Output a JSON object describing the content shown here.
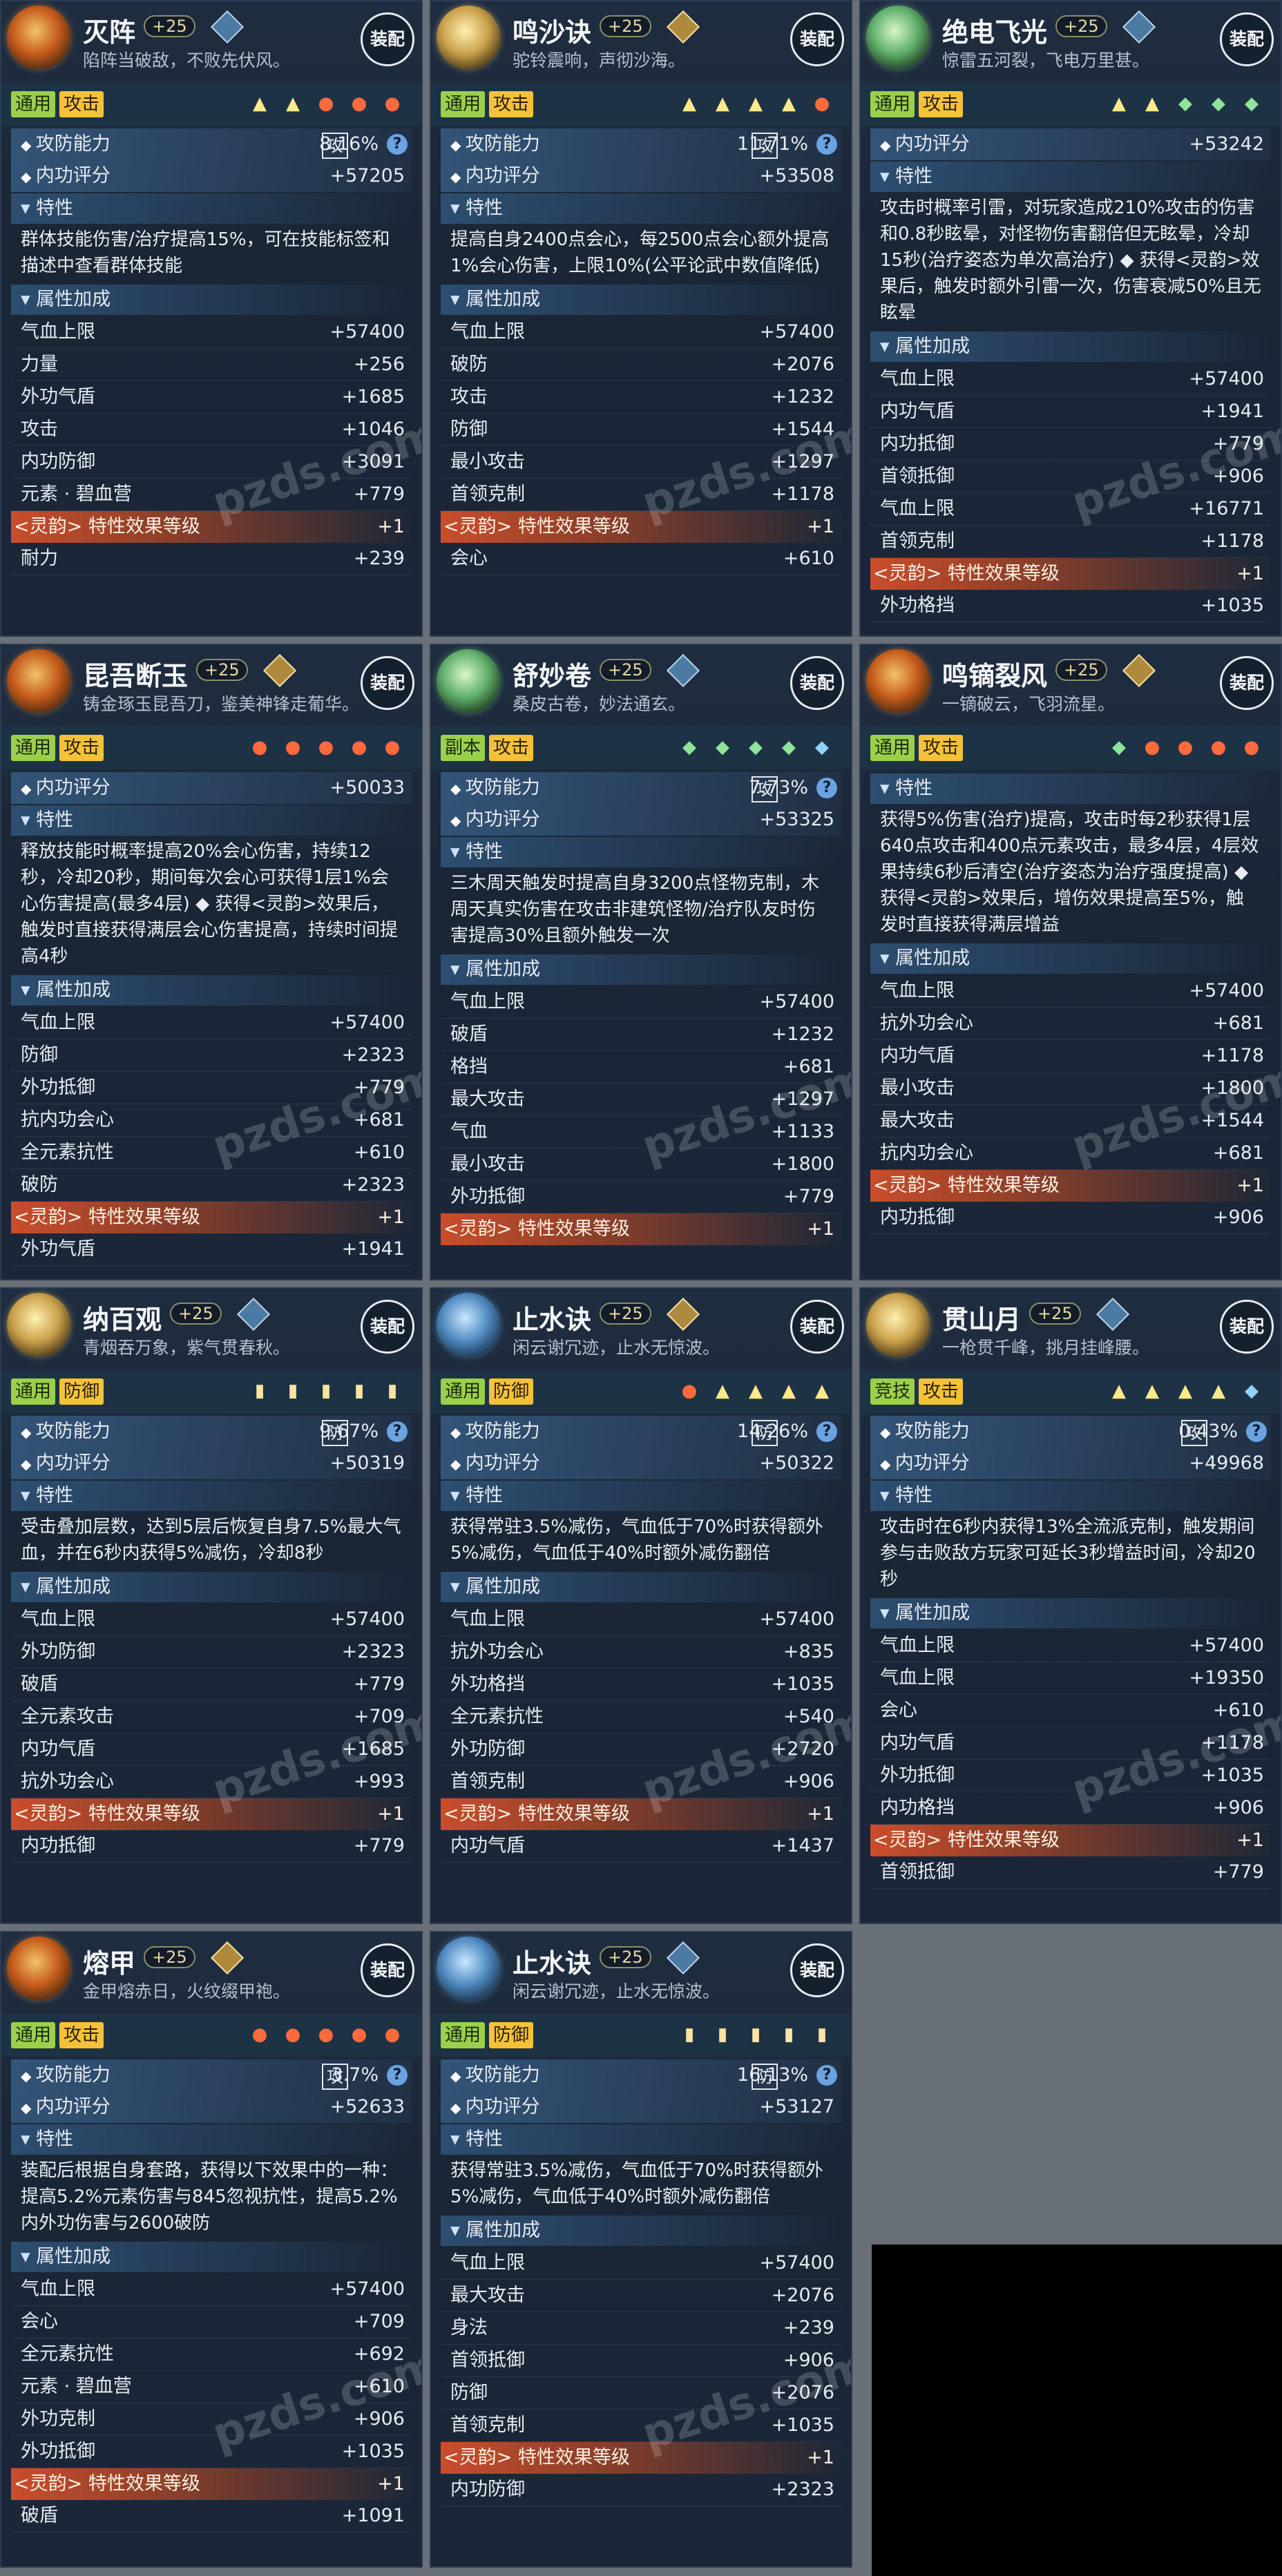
{
  "cards": [
    {
      "name": "灭阵",
      "level": "+25",
      "motto": "陷阵当破敌，不败先伏风。",
      "equip": "装配",
      "tags": [
        "通用",
        "攻击"
      ],
      "stat_badge": "攻",
      "stat_pct": "8.16%",
      "stat_label": "攻防能力",
      "score_label": "内功评分",
      "score": "+57205",
      "trait_title": "特性",
      "trait_text": "群体技能伤害/治疗提高15%，可在技能标签和描述中查看群体技能",
      "attr_title": "属性加成",
      "attrs": [
        [
          "气血上限",
          "+57400"
        ],
        [
          "力量",
          "+256"
        ],
        [
          "外功气盾",
          "+1685"
        ],
        [
          "攻击",
          "+1046"
        ],
        [
          "内功防御",
          "+3091"
        ],
        [
          "元素 · 碧血营",
          "+779"
        ]
      ],
      "glow": [
        "<灵韵> 特性效果等级",
        "+1"
      ],
      "tail": [
        "耐力",
        "+239"
      ]
    },
    {
      "name": "鸣沙诀",
      "level": "+25",
      "motto": "驼铃震响，声彻沙海。",
      "equip": "装配",
      "tags": [
        "通用",
        "攻击"
      ],
      "stat_badge": "攻",
      "stat_pct": "11.71%",
      "stat_label": "攻防能力",
      "score_label": "内功评分",
      "score": "+53508",
      "trait_title": "特性",
      "trait_text": "提高自身2400点会心，每2500点会心额外提高1%会心伤害，上限10%(公平论武中数值降低)",
      "attr_title": "属性加成",
      "attrs": [
        [
          "气血上限",
          "+57400"
        ],
        [
          "破防",
          "+2076"
        ],
        [
          "攻击",
          "+1232"
        ],
        [
          "防御",
          "+1544"
        ],
        [
          "最小攻击",
          "+1297"
        ],
        [
          "首领克制",
          "+1178"
        ]
      ],
      "glow": [
        "<灵韵> 特性效果等级",
        "+1"
      ],
      "tail": [
        "会心",
        "+610"
      ]
    },
    {
      "name": "绝电飞光",
      "level": "+25",
      "motto": "惊雷五河裂，飞电万里甚。",
      "equip": "装配",
      "tags": [
        "通用",
        "攻击"
      ],
      "score_label": "内功评分",
      "score": "+53242",
      "trait_title": "特性",
      "trait_text": "攻击时概率引雷，对玩家造成210%攻击的伤害和0.8秒眩晕，对怪物伤害翻倍但无眩晕，冷却15秒(治疗姿态为单次高治疗) ◆ 获得<灵韵>效果后，触发时额外引雷一次，伤害衰减50%且无眩晕",
      "attr_title": "属性加成",
      "attrs": [
        [
          "气血上限",
          "+57400"
        ],
        [
          "内功气盾",
          "+1941"
        ],
        [
          "内功抵御",
          "+779"
        ],
        [
          "首领抵御",
          "+906"
        ],
        [
          "气血上限",
          "+16771"
        ],
        [
          "首领克制",
          "+1178"
        ]
      ],
      "glow": [
        "<灵韵> 特性效果等级",
        "+1"
      ],
      "tail": [
        "外功格挡",
        "+1035"
      ]
    },
    {
      "name": "昆吾断玉",
      "level": "+25",
      "motto": "铸金琢玉昆吾刀，鉴美神锋走葡华。",
      "equip": "装配",
      "tags": [
        "通用",
        "攻击"
      ],
      "score_label": "内功评分",
      "score": "+50033",
      "trait_title": "特性",
      "trait_text": "释放技能时概率提高20%会心伤害，持续12秒，冷却20秒，期间每次会心可获得1层1%会心伤害提高(最多4层) ◆ 获得<灵韵>效果后，触发时直接获得满层会心伤害提高，持续时间提高4秒",
      "attr_title": "属性加成",
      "attrs": [
        [
          "气血上限",
          "+57400"
        ],
        [
          "防御",
          "+2323"
        ],
        [
          "外功抵御",
          "+779"
        ],
        [
          "抗内功会心",
          "+681"
        ],
        [
          "全元素抗性",
          "+610"
        ],
        [
          "破防",
          "+2323"
        ]
      ],
      "glow": [
        "<灵韵> 特性效果等级",
        "+1"
      ],
      "tail": [
        "外功气盾",
        "+1941"
      ]
    },
    {
      "name": "舒妙卷",
      "level": "+25",
      "motto": "桑皮古卷，妙法通玄。",
      "equip": "装配",
      "tags": [
        "副本",
        "攻击"
      ],
      "stat_badge": "攻",
      "stat_pct": "7.73%",
      "stat_label": "攻防能力",
      "score_label": "内功评分",
      "score": "+53325",
      "trait_title": "特性",
      "trait_text": "三木周天触发时提高自身3200点怪物克制，木周天真实伤害在攻击非建筑怪物/治疗队友时伤害提高30%且额外触发一次",
      "attr_title": "属性加成",
      "attrs": [
        [
          "气血上限",
          "+57400"
        ],
        [
          "破盾",
          "+1232"
        ],
        [
          "格挡",
          "+681"
        ],
        [
          "最大攻击",
          "+1297"
        ],
        [
          "气血",
          "+1133"
        ],
        [
          "最小攻击",
          "+1800"
        ],
        [
          "外功抵御",
          "+779"
        ]
      ],
      "glow": [
        "<灵韵> 特性效果等级",
        "+1"
      ]
    },
    {
      "name": "鸣镝裂风",
      "level": "+25",
      "motto": "一镝破云，飞羽流星。",
      "equip": "装配",
      "tags": [
        "通用",
        "攻击"
      ],
      "trait_title": "特性",
      "trait_text": "获得5%伤害(治疗)提高，攻击时每2秒获得1层640点攻击和400点元素攻击，最多4层，4层效果持续6秒后清空(治疗姿态为治疗强度提高) ◆ 获得<灵韵>效果后，增伤效果提高至5%，触发时直接获得满层增益",
      "attr_title": "属性加成",
      "attrs": [
        [
          "气血上限",
          "+57400"
        ],
        [
          "抗外功会心",
          "+681"
        ],
        [
          "内功气盾",
          "+1178"
        ],
        [
          "最小攻击",
          "+1800"
        ],
        [
          "最大攻击",
          "+1544"
        ],
        [
          "抗内功会心",
          "+681"
        ]
      ],
      "glow": [
        "<灵韵> 特性效果等级",
        "+1"
      ],
      "tail": [
        "内功抵御",
        "+906"
      ]
    },
    {
      "name": "纳百观",
      "level": "+25",
      "motto": "青烟吞万象，紫气贯春秋。",
      "equip": "装配",
      "tags": [
        "通用",
        "防御"
      ],
      "stat_badge": "防",
      "stat_pct": "9.67%",
      "stat_label": "攻防能力",
      "score_label": "内功评分",
      "score": "+50319",
      "trait_title": "特性",
      "trait_text": "受击叠加层数，达到5层后恢复自身7.5%最大气血，并在6秒内获得5%减伤，冷却8秒",
      "attr_title": "属性加成",
      "attrs": [
        [
          "气血上限",
          "+57400"
        ],
        [
          "外功防御",
          "+2323"
        ],
        [
          "破盾",
          "+779"
        ],
        [
          "全元素攻击",
          "+709"
        ],
        [
          "内功气盾",
          "+1685"
        ],
        [
          "抗外功会心",
          "+993"
        ]
      ],
      "glow": [
        "<灵韵> 特性效果等级",
        "+1"
      ],
      "tail": [
        "内功抵御",
        "+779"
      ]
    },
    {
      "name": "止水诀",
      "level": "+25",
      "motto": "闲云谢冗迹，止水无惊波。",
      "equip": "装配",
      "tags": [
        "通用",
        "防御"
      ],
      "stat_badge": "防",
      "stat_pct": "14.26%",
      "stat_label": "攻防能力",
      "score_label": "内功评分",
      "score": "+50322",
      "trait_title": "特性",
      "trait_text": "获得常驻3.5%减伤，气血低于70%时获得额外5%减伤，气血低于40%时额外减伤翻倍",
      "attr_title": "属性加成",
      "attrs": [
        [
          "气血上限",
          "+57400"
        ],
        [
          "抗外功会心",
          "+835"
        ],
        [
          "外功格挡",
          "+1035"
        ],
        [
          "全元素抗性",
          "+540"
        ],
        [
          "外功防御",
          "+2720"
        ],
        [
          "首领克制",
          "+906"
        ]
      ],
      "glow": [
        "<灵韵> 特性效果等级",
        "+1"
      ],
      "tail": [
        "内功气盾",
        "+1437"
      ]
    },
    {
      "name": "贯山月",
      "level": "+25",
      "motto": "一枪贯千峰，挑月挂峰腰。",
      "equip": "装配",
      "tags": [
        "竞技",
        "攻击"
      ],
      "stat_badge": "攻",
      "stat_pct": "0.43%",
      "stat_label": "攻防能力",
      "score_label": "内功评分",
      "score": "+49968",
      "trait_title": "特性",
      "trait_text": "攻击时在6秒内获得13%全流派克制，触发期间参与击败敌方玩家可延长3秒增益时间，冷却20秒",
      "attr_title": "属性加成",
      "attrs": [
        [
          "气血上限",
          "+57400"
        ],
        [
          "气血上限",
          "+19350"
        ],
        [
          "会心",
          "+610"
        ],
        [
          "内功气盾",
          "+1178"
        ],
        [
          "外功抵御",
          "+1035"
        ],
        [
          "内功格挡",
          "+906"
        ]
      ],
      "glow": [
        "<灵韵> 特性效果等级",
        "+1"
      ],
      "tail": [
        "首领抵御",
        "+779"
      ]
    },
    {
      "name": "熔甲",
      "level": "+25",
      "motto": "金甲熔赤日，火纹缀甲袍。",
      "equip": "装配",
      "tags": [
        "通用",
        "攻击"
      ],
      "stat_badge": "攻",
      "stat_pct": "3.7%",
      "stat_label": "攻防能力",
      "score_label": "内功评分",
      "score": "+52633",
      "trait_title": "特性",
      "trait_text": "装配后根据自身套路，获得以下效果中的一种：提高5.2%元素伤害与845忽视抗性，提高5.2%内外功伤害与2600破防",
      "attr_title": "属性加成",
      "attrs": [
        [
          "气血上限",
          "+57400"
        ],
        [
          "会心",
          "+709"
        ],
        [
          "全元素抗性",
          "+692"
        ],
        [
          "元素 · 碧血营",
          "+610"
        ],
        [
          "外功克制",
          "+906"
        ],
        [
          "外功抵御",
          "+1035"
        ]
      ],
      "glow": [
        "<灵韵> 特性效果等级",
        "+1"
      ],
      "tail": [
        "破盾",
        "+1091"
      ]
    },
    {
      "name": "止水诀",
      "level": "+25",
      "motto": "闲云谢冗迹，止水无惊波。",
      "equip": "装配",
      "tags": [
        "通用",
        "防御"
      ],
      "stat_badge": "防",
      "stat_pct": "16.13%",
      "stat_label": "攻防能力",
      "score_label": "内功评分",
      "score": "+53127",
      "trait_title": "特性",
      "trait_text": "获得常驻3.5%减伤，气血低于70%时获得额外5%减伤，气血低于40%时额外减伤翻倍",
      "attr_title": "属性加成",
      "attrs": [
        [
          "气血上限",
          "+57400"
        ],
        [
          "最大攻击",
          "+2076"
        ],
        [
          "身法",
          "+239"
        ],
        [
          "首领抵御",
          "+906"
        ],
        [
          "防御",
          "+2076"
        ],
        [
          "首领克制",
          "+1035"
        ]
      ],
      "glow": [
        "<灵韵> 特性效果等级",
        "+1"
      ],
      "tail": [
        "内功防御",
        "+2323"
      ]
    }
  ],
  "watermark": "pzds.com"
}
